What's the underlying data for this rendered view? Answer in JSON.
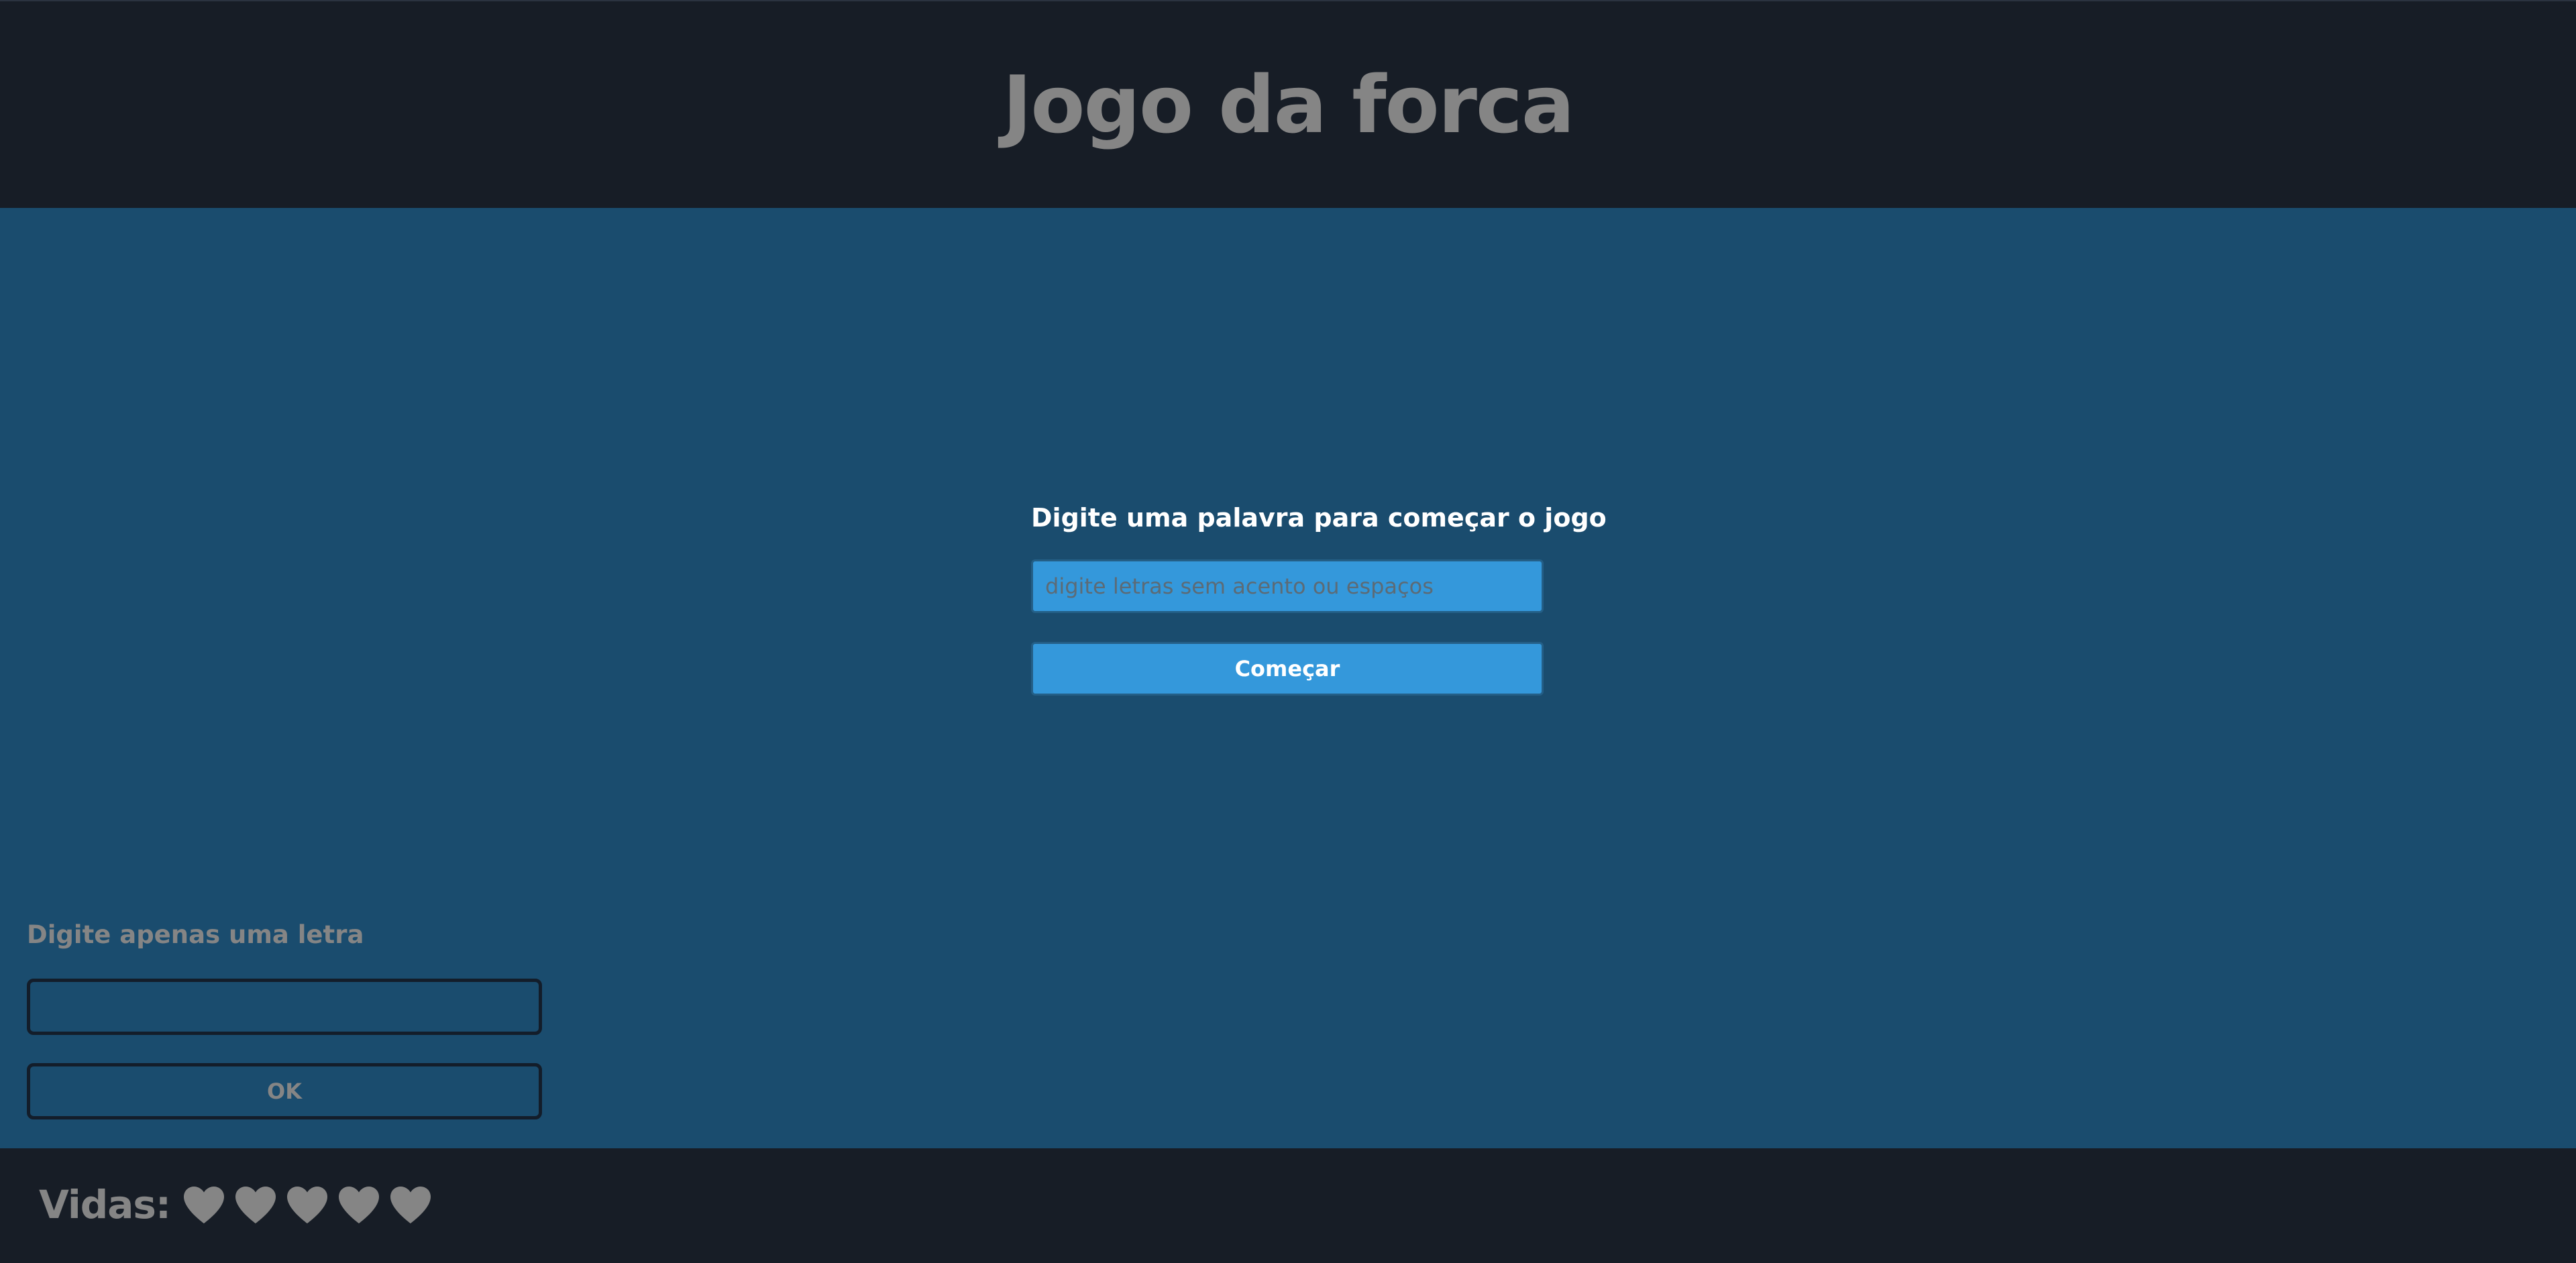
{
  "header": {
    "title": "Jogo da forca"
  },
  "start": {
    "label": "Digite uma palavra para começar o jogo",
    "input_placeholder": "digite letras sem acento ou espaços",
    "input_value": "",
    "button_label": "Começar"
  },
  "guess": {
    "label": "Digite apenas uma letra",
    "input_value": "",
    "button_label": "OK"
  },
  "footer": {
    "lives_label": "Vidas:",
    "lives_count": 5,
    "heart_icon": "heart-icon",
    "heart_color": "#858585"
  },
  "colors": {
    "header_bg": "#171d26",
    "main_bg": "#1a4c6e",
    "accent_blue": "#3498db",
    "muted_text": "#858585"
  }
}
